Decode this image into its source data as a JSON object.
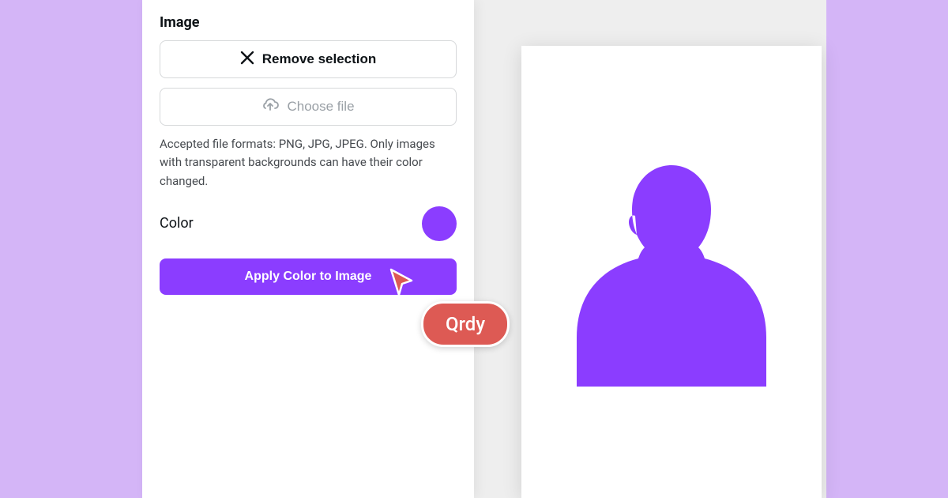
{
  "sidebar": {
    "section_title": "Image",
    "remove_button_label": "Remove selection",
    "choose_file_label": "Choose file",
    "help_text": "Accepted file formats: PNG, JPG, JPEG. Only images with transparent backgrounds can have their color changed.",
    "color_label": "Color",
    "selected_color": "#8b3dff",
    "apply_button_label": "Apply Color to Image"
  },
  "canvas": {
    "silhouette_color": "#8b3dff"
  },
  "cursor": {
    "label": "Qrdy",
    "color": "#dd5a54"
  },
  "colors": {
    "background_lavender": "#d4b5f7",
    "accent_purple": "#8b3dff",
    "cursor_red": "#dd5a54"
  }
}
